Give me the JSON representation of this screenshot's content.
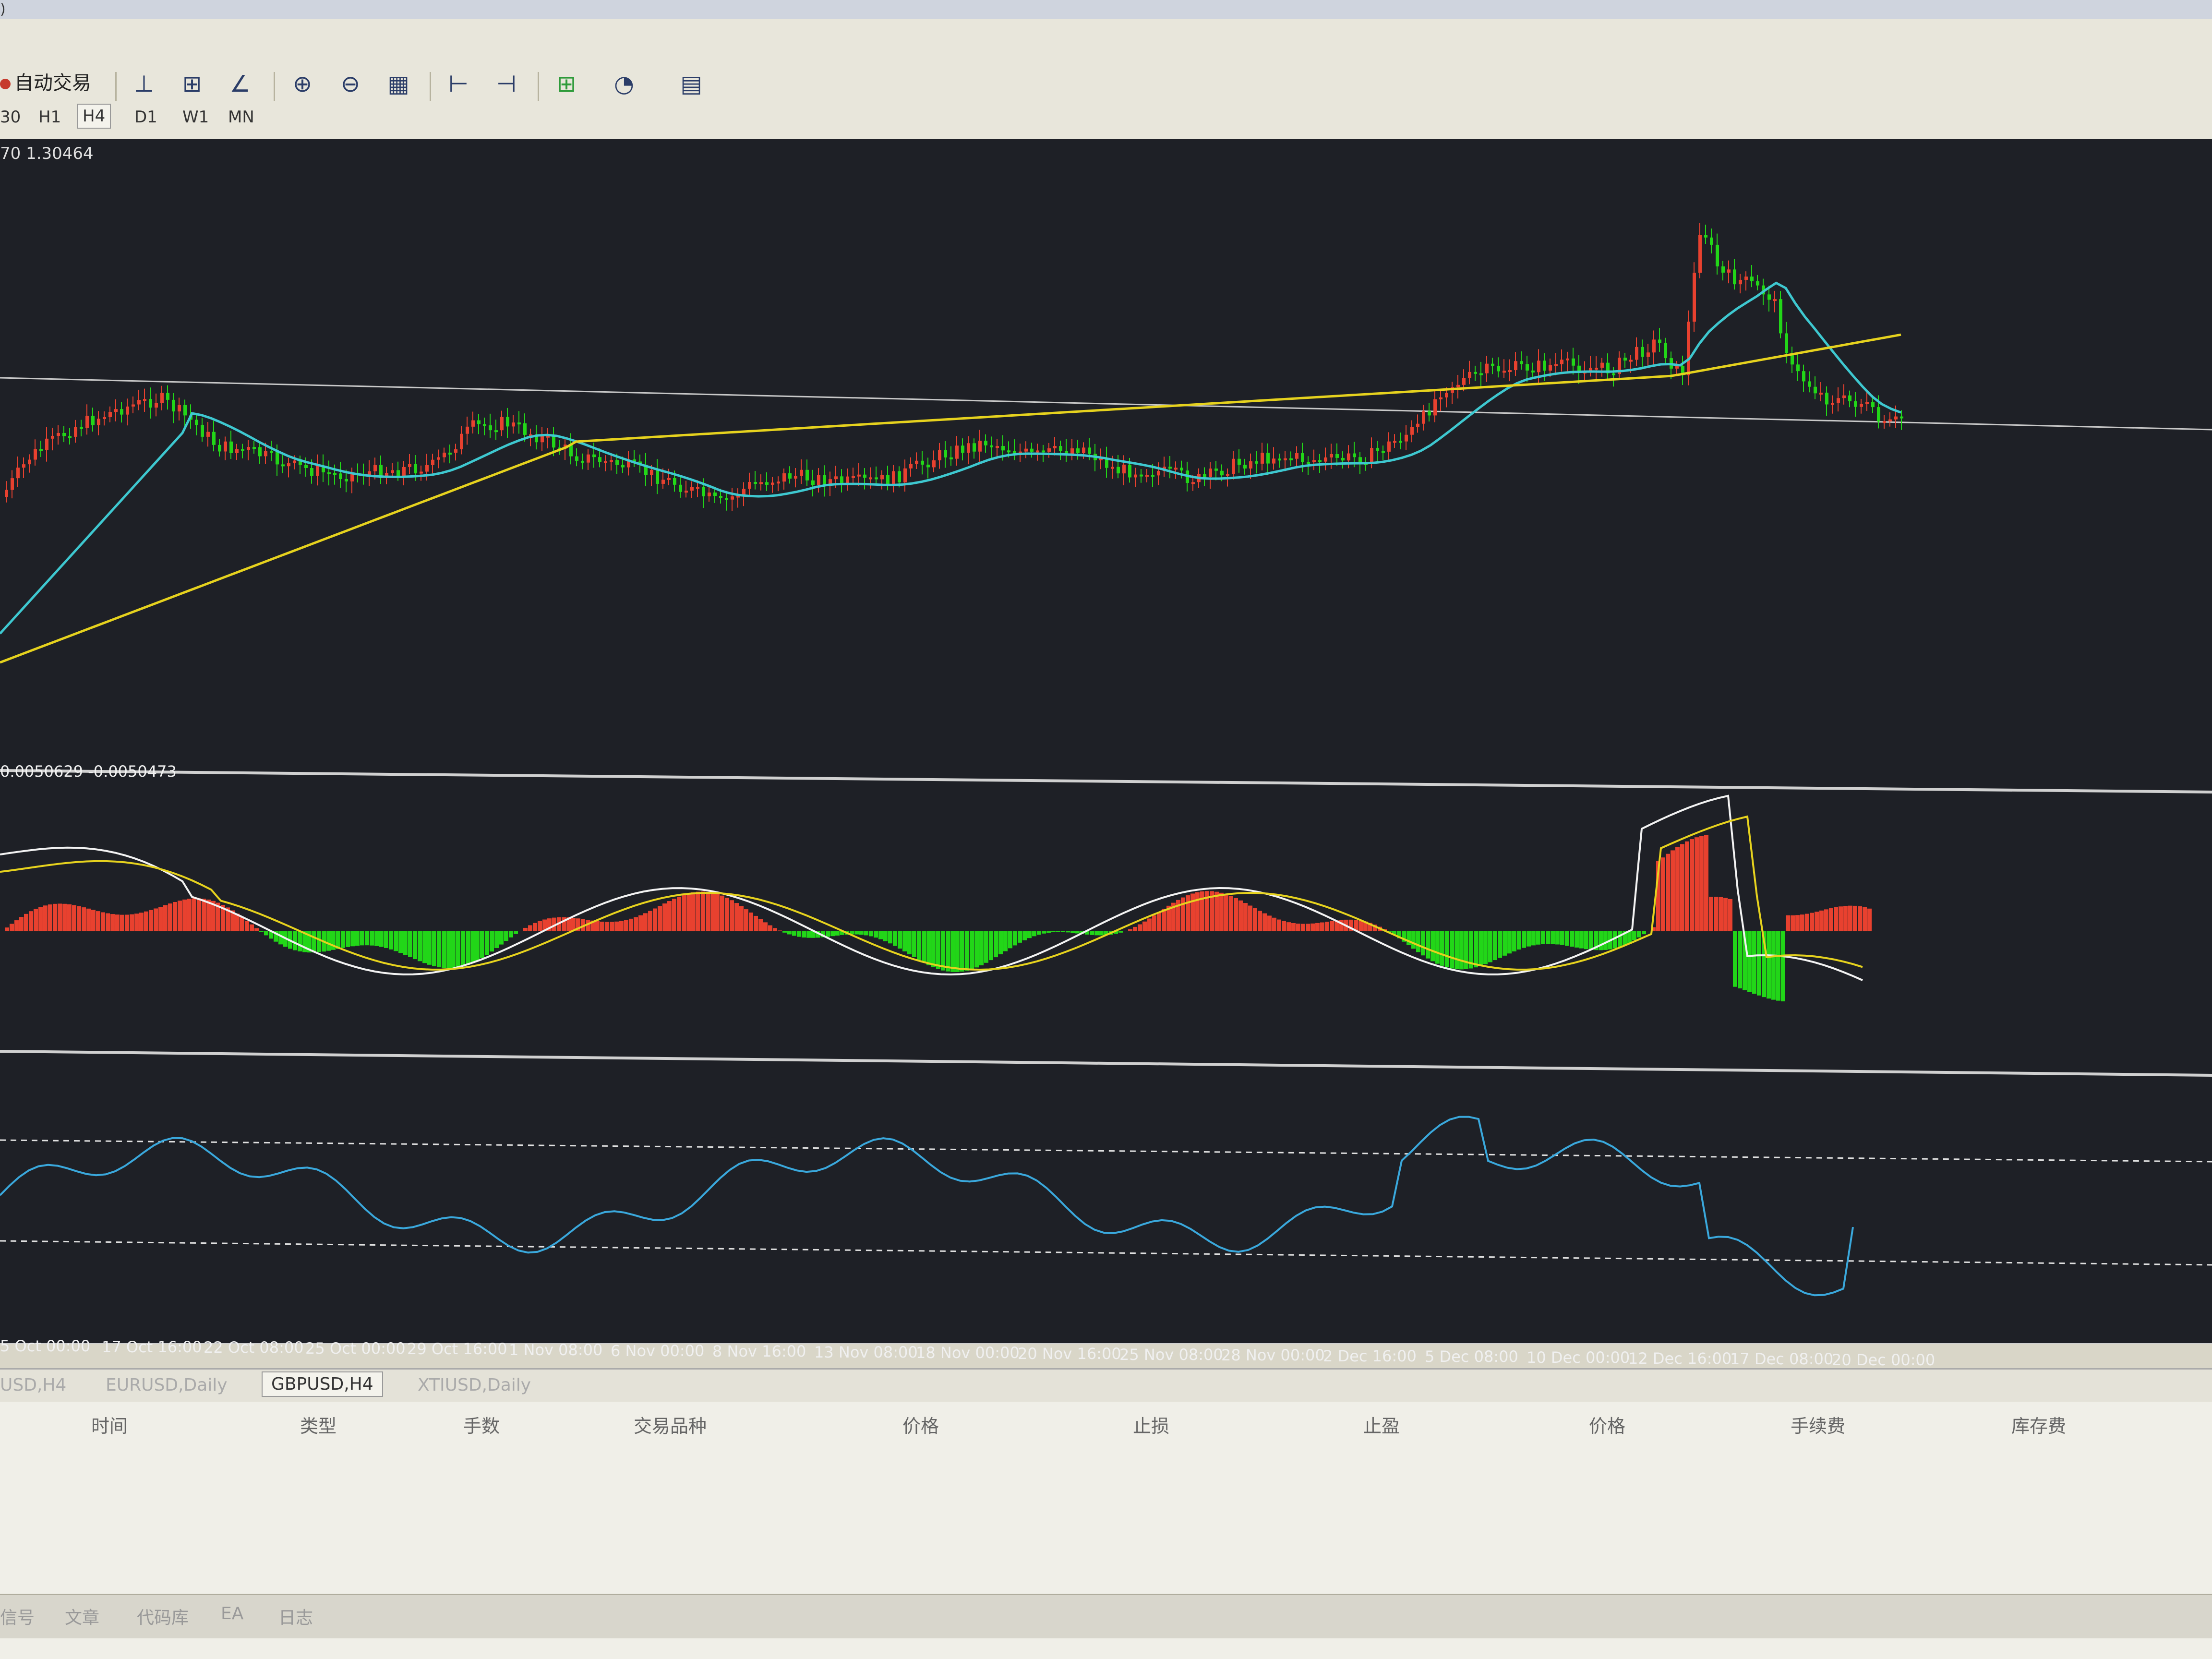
{
  "window": {
    "title_fragment": ")"
  },
  "toolbar": {
    "auto_trade": "自动交易"
  },
  "timeframes": [
    "30",
    "H1",
    "H4",
    "D1",
    "W1",
    "MN"
  ],
  "price_panel": {
    "info": "70 1.30464"
  },
  "macd_panel": {
    "info": "0.0050629 -0.0050473"
  },
  "x_axis_labels": [
    "5 Oct 00:00",
    "17 Oct 16:00",
    "22 Oct 08:00",
    "25 Oct 00:00",
    "29 Oct 16:00",
    "1 Nov 08:00",
    "6 Nov 00:00",
    "8 Nov 16:00",
    "13 Nov 08:00",
    "18 Nov 00:00",
    "20 Nov 16:00",
    "25 Nov 08:00",
    "28 Nov 00:00",
    "2 Dec 16:00",
    "5 Dec 08:00",
    "10 Dec 00:00",
    "12 Dec 16:00",
    "17 Dec 08:00",
    "20 Dec 00:00"
  ],
  "chart_tabs": [
    "USD,H4",
    "EURUSD,Daily",
    "GBPUSD,H4",
    "XTIUSD,Daily"
  ],
  "active_tab_index": 2,
  "terminal_columns": [
    "时间",
    "类型",
    "手数",
    "交易品种",
    "价格",
    "止损",
    "止盈",
    "价格",
    "手续费",
    "库存费"
  ],
  "bottom_tabs": [
    "信号",
    "文章",
    "代码库",
    "EA",
    "日志"
  ],
  "colors": {
    "chart_bg": "#1e2026",
    "bull": "#e8412f",
    "bear": "#22d618",
    "ma_fast": "#3ec8d0",
    "ma_slow": "#e6d21e",
    "macd_line": "#f2f2f2",
    "signal_line": "#e6d21e",
    "rsi_line": "#3aa8dc"
  }
}
